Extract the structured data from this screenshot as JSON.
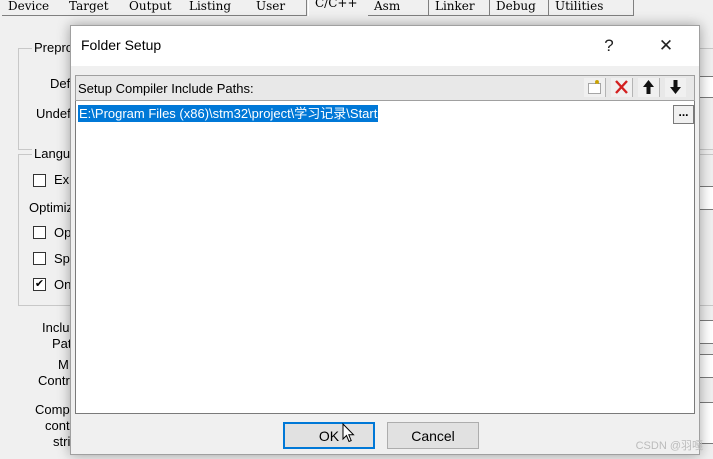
{
  "tabs": [
    "Device",
    "Target",
    "Output",
    "Listing",
    "User",
    "C/C++",
    "Asm",
    "Linker",
    "Debug",
    "Utilities"
  ],
  "active_tab": "C/C++",
  "background": {
    "preprocessor_group": "Prepro",
    "define_label": "Def",
    "undefine_label": "Undef",
    "language_group": "Langu",
    "check_ex": "Ex",
    "optimization_label": "Optimiz",
    "check_op": "Op",
    "check_sp": "Sp",
    "check_on": "On",
    "include_label": "Inclu",
    "paths_label": "Pat",
    "misc_label": "M",
    "controls_label": "Contr",
    "compiler_label": "Comp",
    "control_label": "cont",
    "string_label": "stri"
  },
  "dialog": {
    "title": "Folder Setup",
    "help_symbol": "?",
    "close_symbol": "✕",
    "list_header": "Setup Compiler Include Paths:",
    "path_value": "E:\\Program Files (x86)\\stm32\\project\\学习记录\\Start",
    "browse_label": "...",
    "ok_label": "OK",
    "cancel_label": "Cancel"
  },
  "toolbar_icons": [
    "new-folder-icon",
    "delete-icon",
    "move-up-icon",
    "move-down-icon"
  ],
  "colors": {
    "selection": "#0078d7",
    "delete_red": "#d32020",
    "focus_border": "#0078d7"
  },
  "watermark": "CSDN @羽嘎"
}
